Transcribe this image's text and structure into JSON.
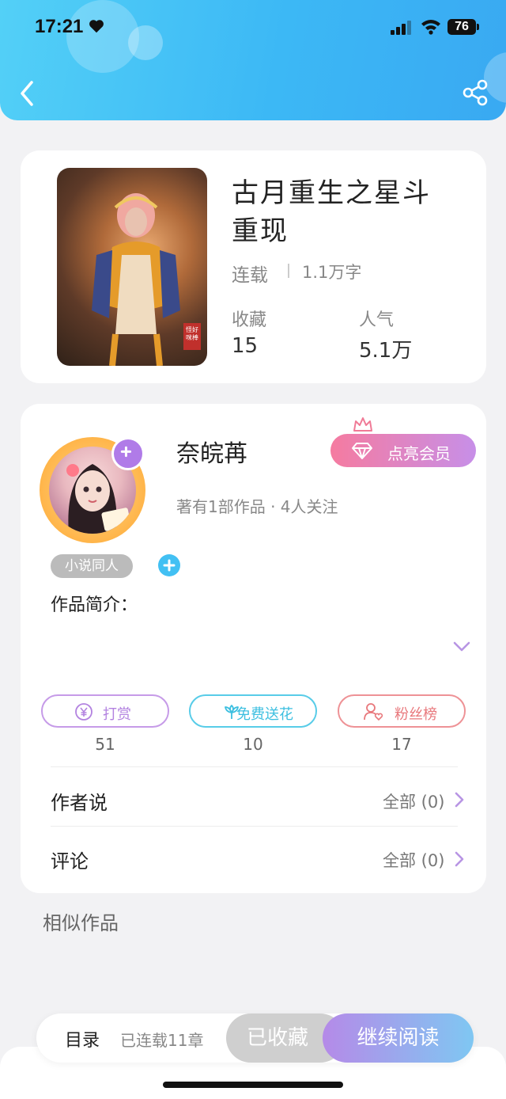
{
  "status_bar": {
    "time": "17:21",
    "battery": "76"
  },
  "header": {
    "back_icon": "chevron-left-icon",
    "share_icon": "share-icon"
  },
  "book": {
    "title_line1": "古月重生之星斗",
    "title_line2": "重现",
    "status": "连载",
    "words": "1.1万字",
    "favorites_label": "收藏",
    "favorites_value": "15",
    "popularity_label": "人气",
    "popularity_value": "5.1万",
    "seal_text": "怪好 咪棒"
  },
  "author": {
    "name": "奈皖苒",
    "meta": "著有1部作品 · 4人关注",
    "vip_label": "点亮会员",
    "tag": "小说同人",
    "intro_label": "作品简介："
  },
  "actions": [
    {
      "label": "打赏",
      "count": "51",
      "icon": "yen-coin-icon"
    },
    {
      "label": "免费送花",
      "count": "10",
      "icon": "flower-icon"
    },
    {
      "label": "粉丝榜",
      "count": "17",
      "icon": "user-heart-icon"
    }
  ],
  "rows": [
    {
      "label": "作者说",
      "right": "全部 (0)"
    },
    {
      "label": "评论",
      "right": "全部 (0)"
    }
  ],
  "similar_label": "相似作品",
  "bottom_bar": {
    "toc_label": "目录",
    "chapters": "已连载11章",
    "collected_label": "已收藏",
    "continue_label": "继续阅读"
  },
  "colors": {
    "header_gradient": [
      "#53d0f7",
      "#39a9f2"
    ],
    "vip_gradient": [
      "#f57ba0",
      "#c78fe8"
    ],
    "reward": "#b383e0",
    "flower": "#3cbfe0",
    "fans": "#e8787c"
  }
}
